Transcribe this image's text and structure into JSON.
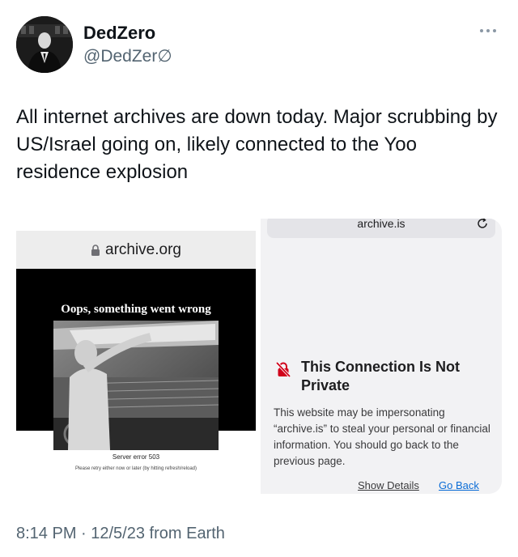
{
  "author": {
    "display_name": "DedZero",
    "handle": "@DedZer∅"
  },
  "tweet": {
    "text": "All internet archives are down today. Major scrubbing by US/Israel going on, likely connected to the Yoo residence explosion",
    "timestamp": "8:14 PM · 12/5/23 from Earth"
  },
  "media": {
    "left": {
      "url": "archive.org",
      "error_heading": "Oops, something went wrong",
      "server_error": "Server error 503",
      "retry_text": "Please retry either now or later (by hitting refresh/reload)"
    },
    "right": {
      "url": "archive.is",
      "warning_title": "This Connection Is Not Private",
      "warning_body": "This website may be impersonating “archive.is” to steal your personal or financial information. You should go back to the previous page.",
      "show_details": "Show Details",
      "go_back": "Go Back"
    }
  },
  "icons": {
    "more": "more-horizontal-icon",
    "lock": "lock-icon",
    "reload": "reload-icon",
    "warning": "broken-lock-warning-icon"
  },
  "colors": {
    "warning_red": "#d0021b",
    "link_blue": "#0a6cd6",
    "secondary_text": "#536471"
  }
}
